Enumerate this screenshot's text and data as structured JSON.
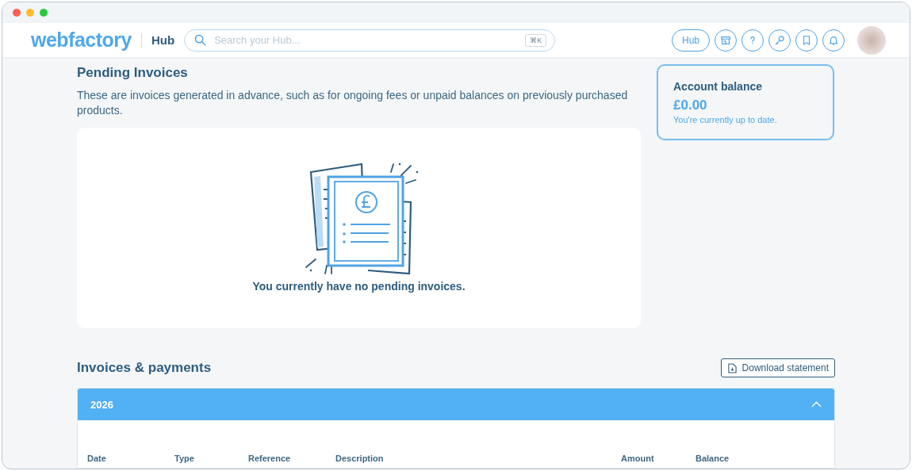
{
  "header": {
    "logo": "webfactory",
    "section": "Hub",
    "search": {
      "placeholder": "Search your Hub...",
      "shortcut": "⌘K"
    },
    "hub_button": "Hub"
  },
  "pending": {
    "title": "Pending Invoices",
    "description": "These are invoices generated in advance, such as for ongoing fees or unpaid balances on previously purchased products.",
    "empty_message": "You currently have no pending invoices."
  },
  "account_balance": {
    "title": "Account balance",
    "amount": "£0.00",
    "note": "You're currently up to date."
  },
  "invoices": {
    "title": "Invoices & payments",
    "download_button": "Download statement",
    "year_group": {
      "year": "2026",
      "expanded": true,
      "columns": [
        "Date",
        "Type",
        "Reference",
        "Description",
        "Amount",
        "Balance"
      ]
    }
  }
}
